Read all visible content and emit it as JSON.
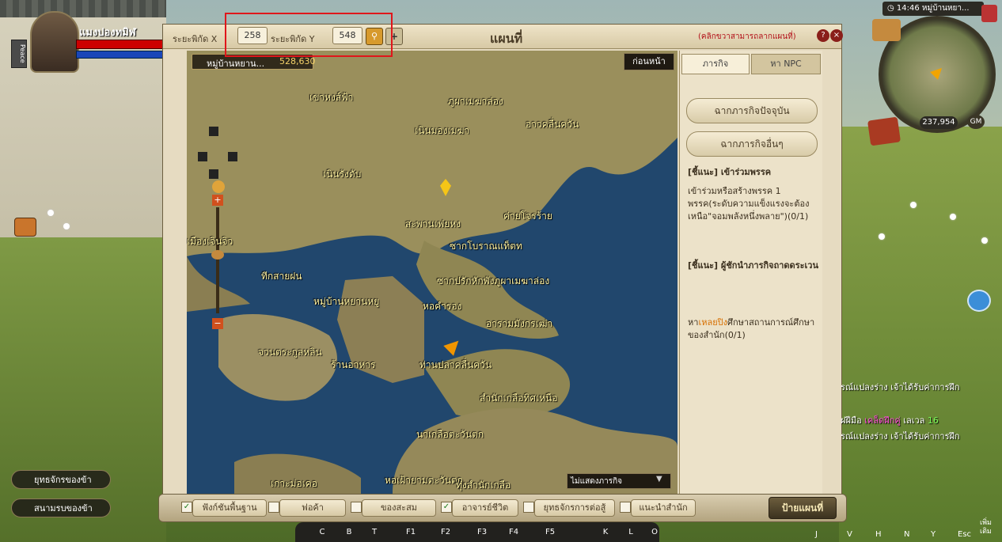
{
  "player": {
    "name": "แมงปองทมิฬ",
    "mode": "Peace"
  },
  "minimap": {
    "time": "14:46",
    "location": "หมู่บ้านหยา...",
    "coord": "237,954",
    "gm": "GM"
  },
  "titlebar": {
    "x_label": "ระยะพิกัด X",
    "x_value": "258",
    "y_label": "ระยะพิกัด Y",
    "y_value": "548",
    "title": "แผนที่",
    "hint": "(คลิกขวาสามารถลากแผนที่)"
  },
  "map": {
    "current_location": "หมู่บ้านหยาน...",
    "current_coord": "528,630",
    "prev_button": "ก่อนหน้า",
    "filter_select": "ไม่แสดงภารกิจ",
    "labels": [
      "เขาหงส์ฟ้า",
      "ภูผาเมฆาล่อง",
      "เนินมองเมฆา",
      "อาวคลื่นควัน",
      "เนินรังดับ",
      "สะพานเฟยหง",
      "ค่ายโจรร้าย",
      "ซากโบราณแท็ตท",
      "เมืองเจินจิว",
      "ทีกสายฝน",
      "ซากปรักหักพังภูผาเมฆาล่อง",
      "หมู่บ้านหยานหยู",
      "หอคำรอง",
      "อารามมังกรเฒ่า",
      "จวนตระกูลหลิน",
      "ท่านปลาคลื่นควัน",
      "สำนักเกลือทิศเหนือ",
      "นาเกลือตะวันตก",
      "เกาะม่อเคอ",
      "หอเฝ้ายามตะวันตก",
      "ทุ่งสำนักเกลือ",
      "ร้านอาหาร"
    ]
  },
  "side": {
    "tab_quest": "ภารกิจ",
    "tab_npc": "หา NPC",
    "btn_current": "ฉากภารกิจปัจจุบัน",
    "btn_other": "ฉากภารกิจอื่นๆ",
    "q1_title": "[ชี้แนะ] เข้าร่วมพรรค",
    "q1_body": "เข้าร่วมหรือสร้างพรรค 1 พรรค(ระดับความแข็งแรงจะต้องเหนือ\"จอมพลังหนึ่งพลาย\")(0/1)",
    "q2_title": "[ชี้แนะ] ผู้ชักนำภารกิจถาดดระเวน",
    "q2_pre": "หา",
    "q2_npc": "เหลยปิง",
    "q2_post": "ศึกษาสถานการณ์ศึกษาของสำนัก(0/1)"
  },
  "filters": [
    {
      "label": "ฟังก์ชันพื้นฐาน",
      "checked": true
    },
    {
      "label": "ฟอค้า",
      "checked": false
    },
    {
      "label": "ของสะสม",
      "checked": false
    },
    {
      "label": "อาจารย์ชีวิต",
      "checked": true
    },
    {
      "label": "ยุทธจักรการต่อสู้",
      "checked": false
    },
    {
      "label": "แนะนำสำนัก",
      "checked": false
    }
  ],
  "sign_button": "ป้ายแผนที่",
  "hotkeys": [
    "C",
    "B",
    "T",
    "F1",
    "F2",
    "F3",
    "F4",
    "F5",
    "K",
    "L",
    "O"
  ],
  "left_buttons": [
    "ยุทธจักรของข้า",
    "สนามรบของข้า"
  ],
  "chat": [
    "รณ์แปลงร่าง เจ้าได้รับค่าการฝึก",
    "ฝฝีมือ",
    "เคล็ดฝึกคู่",
    "เลเวล",
    "16",
    "รณ์แปลงร่าง เจ้าได้รับค่าการฝึก"
  ],
  "right_hotkeys": [
    "J",
    "V",
    "H",
    "N",
    "Y",
    "Esc"
  ],
  "more_label": "เพิ่มเติม",
  "colors": {
    "accent": "#e0161b",
    "highlight": "#d76f00",
    "map_water": "#21476d",
    "map_land": "#9a8f5c"
  }
}
